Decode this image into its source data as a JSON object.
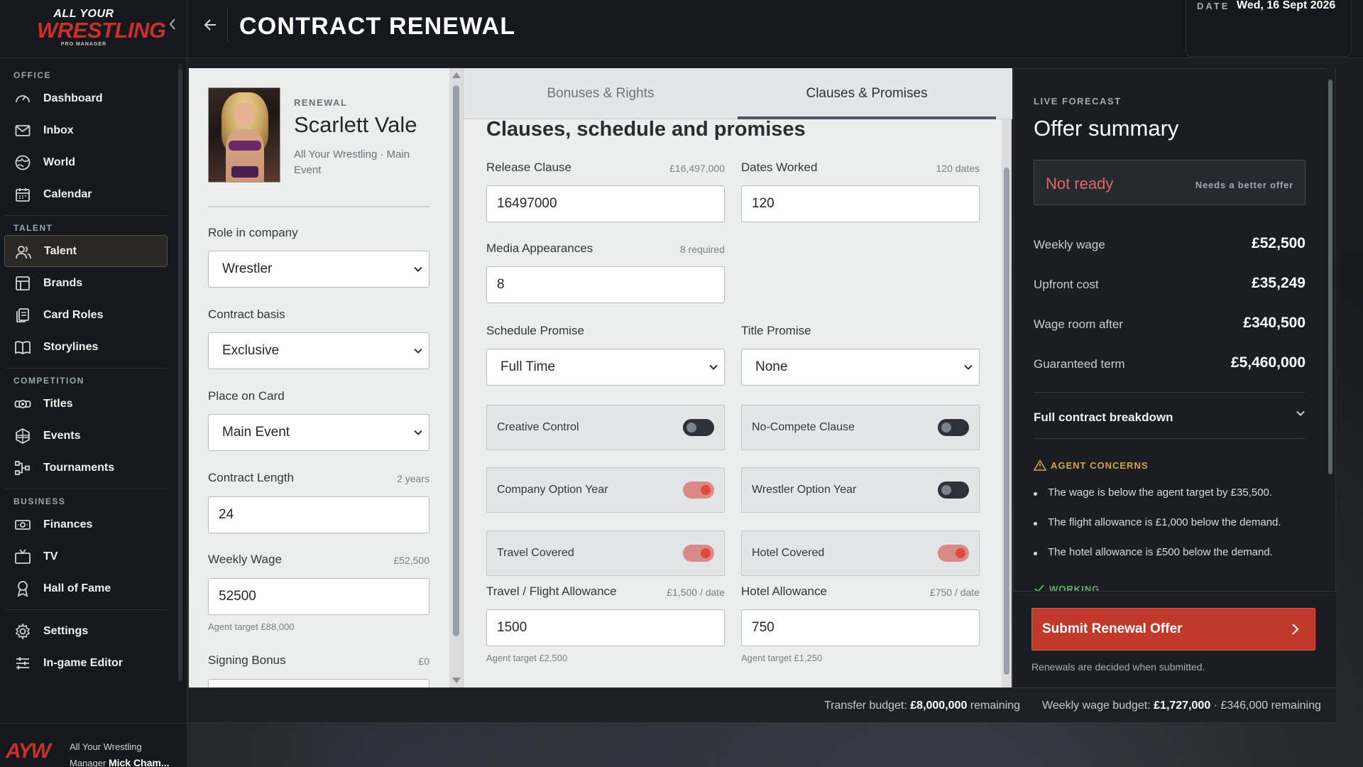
{
  "brand": {
    "line1": "ALL YOUR",
    "line2": "WRESTLING",
    "line3": "PRO MANAGER"
  },
  "header": {
    "title": "CONTRACT RENEWAL",
    "date_label": "DATE",
    "date_value": "Wed, 16 Sept 2026"
  },
  "sidebar": {
    "sections": {
      "office": "OFFICE",
      "talent": "TALENT",
      "competition": "COMPETITION",
      "business": "BUSINESS"
    },
    "items": {
      "dashboard": "Dashboard",
      "inbox": "Inbox",
      "world": "World",
      "calendar": "Calendar",
      "talent": "Talent",
      "brands": "Brands",
      "card_roles": "Card Roles",
      "storylines": "Storylines",
      "titles": "Titles",
      "events": "Events",
      "tournaments": "Tournaments",
      "finances": "Finances",
      "tv": "TV",
      "hall_of_fame": "Hall of Fame",
      "settings": "Settings",
      "editor": "In-game Editor"
    },
    "active": "talent",
    "footer": {
      "logo": "AYW",
      "line1": "All Your Wrestling",
      "manager_label": "Manager",
      "manager_name": "Mick Cham..."
    }
  },
  "wrestler": {
    "kicker": "RENEWAL",
    "name": "Scarlett Vale",
    "subtitle": "All Your Wrestling · Main Event"
  },
  "left_form": {
    "role_label": "Role in company",
    "role_value": "Wrestler",
    "basis_label": "Contract basis",
    "basis_value": "Exclusive",
    "place_label": "Place on Card",
    "place_value": "Main Event",
    "length_label": "Contract Length",
    "length_hint": "2 years",
    "length_value": "24",
    "wage_label": "Weekly Wage",
    "wage_hint": "£52,500",
    "wage_value": "52500",
    "wage_help": "Agent target £88,000",
    "bonus_label": "Signing Bonus",
    "bonus_hint": "£0"
  },
  "tabs": [
    {
      "label": "Bonuses & Rights",
      "active": false
    },
    {
      "label": "Clauses & Promises",
      "active": true
    }
  ],
  "clauses": {
    "heading": "Clauses, schedule and promises",
    "release_label": "Release Clause",
    "release_hint": "£16,497,000",
    "release_value": "16497000",
    "dates_label": "Dates Worked",
    "dates_hint": "120 dates",
    "dates_value": "120",
    "media_label": "Media Appearances",
    "media_hint": "8 required",
    "media_value": "8",
    "schedule_label": "Schedule Promise",
    "schedule_value": "Full Time",
    "title_label": "Title Promise",
    "title_value": "None",
    "toggles": {
      "creative_control": {
        "label": "Creative Control",
        "on": false
      },
      "no_compete": {
        "label": "No-Compete Clause",
        "on": false
      },
      "company_option": {
        "label": "Company Option Year",
        "on": true
      },
      "wrestler_option": {
        "label": "Wrestler Option Year",
        "on": false
      },
      "travel_covered": {
        "label": "Travel Covered",
        "on": true
      },
      "hotel_covered": {
        "label": "Hotel Covered",
        "on": true
      }
    },
    "flight_label": "Travel / Flight Allowance",
    "flight_hint": "£1,500 / date",
    "flight_value": "1500",
    "flight_help": "Agent target £2,500",
    "hotel_label": "Hotel Allowance",
    "hotel_hint": "£750 / date",
    "hotel_value": "750",
    "hotel_help": "Agent target £1,250"
  },
  "summary": {
    "kicker": "LIVE FORECAST",
    "title": "Offer summary",
    "status": "Not ready",
    "status_note": "Needs a better offer",
    "rows": [
      {
        "label": "Weekly wage",
        "value": "£52,500"
      },
      {
        "label": "Upfront cost",
        "value": "£35,249"
      },
      {
        "label": "Wage room after",
        "value": "£340,500"
      },
      {
        "label": "Guaranteed term",
        "value": "£5,460,000"
      }
    ],
    "breakdown": "Full contract breakdown",
    "concerns_title": "AGENT CONCERNS",
    "concerns": [
      "The wage is below the agent target by £35,500.",
      "The flight allowance is £1,000 below the demand.",
      "The hotel allowance is £500 below the demand."
    ],
    "working_title": "WORKING",
    "submit_label": "Submit Renewal Offer",
    "submit_note": "Renewals are decided when submitted."
  },
  "footer_bar": {
    "transfer_label": "Transfer budget:",
    "transfer_value": "£8,000,000",
    "transfer_suffix": "remaining",
    "wage_label": "Weekly wage budget:",
    "wage_value": "£1,727,000",
    "wage_suffix": "· £346,000 remaining"
  },
  "colors": {
    "accent_red": "#c0392b",
    "status_red": "#e2685d",
    "warning": "#d4a54a",
    "ok_green": "#5fae6a"
  }
}
